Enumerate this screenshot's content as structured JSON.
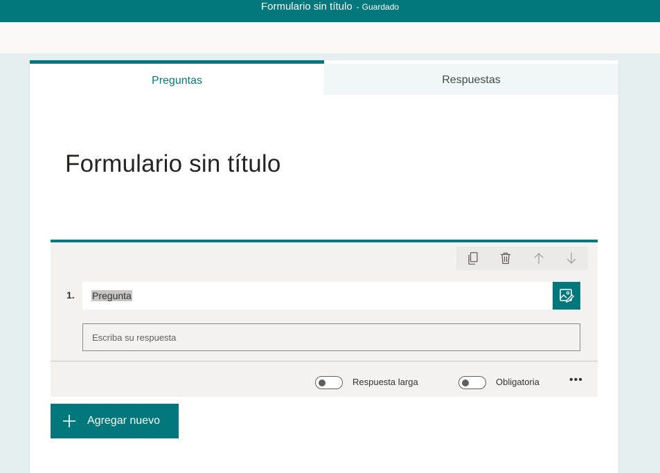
{
  "window": {
    "title": "Formulario sin título",
    "separator": "-",
    "status": "Guardado"
  },
  "tabs": [
    {
      "label": "Preguntas",
      "active": true
    },
    {
      "label": "Respuestas",
      "active": false
    }
  ],
  "form": {
    "title": "Formulario sin título"
  },
  "question": {
    "number": "1.",
    "text": "Pregunta",
    "answer_placeholder": "Escriba su respuesta",
    "actions": [
      "copy-icon",
      "trash-icon",
      "arrow-up-icon",
      "arrow-down-icon"
    ],
    "toggles": [
      {
        "label": "Respuesta larga",
        "on": false
      },
      {
        "label": "Obligatoria",
        "on": false
      }
    ],
    "more_label": "•••"
  },
  "add_button": {
    "label": "Agregar nuevo"
  },
  "colors": {
    "accent": "#03787c",
    "tab_inactive_bg": "#f1f7f7",
    "question_bg": "#f3f2f1",
    "page_bg": "#e6eff0"
  }
}
